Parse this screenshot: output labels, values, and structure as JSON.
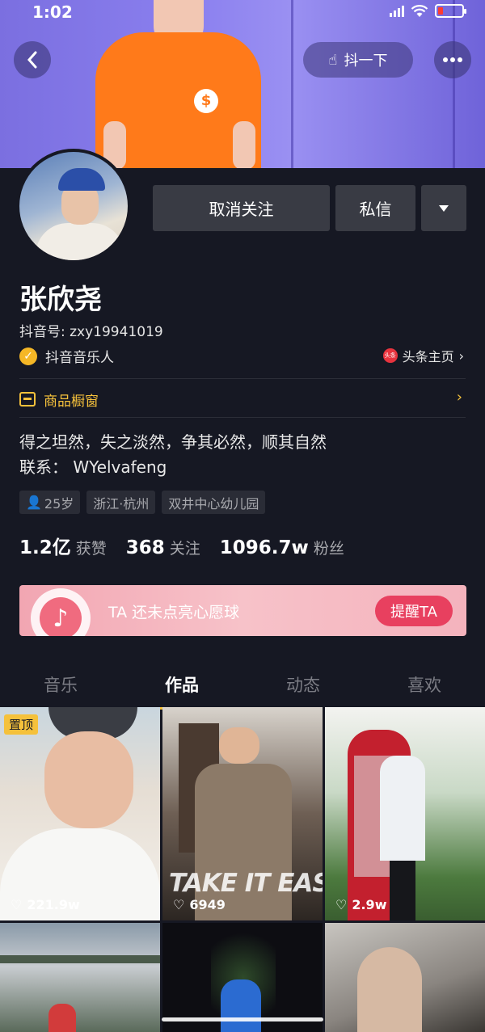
{
  "status_bar": {
    "time": "1:02"
  },
  "header": {
    "shake_label": "抖一下"
  },
  "profile": {
    "follow_button": "取消关注",
    "message_button": "私信",
    "name": "张欣尧",
    "douyin_id": "抖音号: zxy19941019",
    "verified_label": "抖音音乐人",
    "toutiao_link": "头条主页",
    "toutiao_badge": "头条",
    "shop_label": "商品橱窗",
    "bio_line1": "得之坦然，失之淡然，争其必然，顺其自然",
    "bio_line2": "联系： WYelvafeng",
    "tags": [
      "25岁",
      "浙江·杭州",
      "双井中心幼儿园"
    ]
  },
  "stats": {
    "likes_num": "1.2亿",
    "likes_label": "获赞",
    "following_num": "368",
    "following_label": "关注",
    "fans_num": "1096.7w",
    "fans_label": "粉丝"
  },
  "banner": {
    "text": "TA 还未点亮心愿球",
    "button": "提醒TA"
  },
  "tabs": [
    "音乐",
    "作品",
    "动态",
    "喜欢"
  ],
  "videos": [
    {
      "likes": "221.9w",
      "pinned": "置顶"
    },
    {
      "likes": "6949",
      "overlay": "TAKE IT EASY"
    },
    {
      "likes": "2.9w"
    }
  ],
  "colors": {
    "background": "#161823",
    "accent": "#f5c13b",
    "banner_button": "#e8405f"
  }
}
